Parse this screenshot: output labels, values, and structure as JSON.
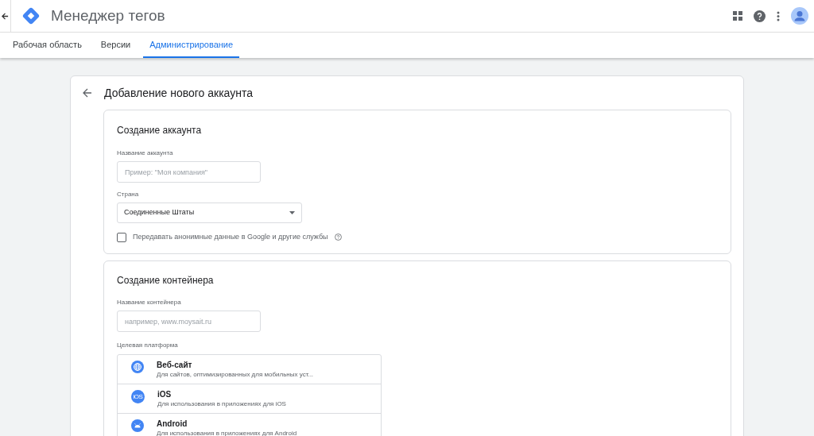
{
  "app_title": "Менеджер тегов",
  "tabs": [
    {
      "label": "Рабочая область",
      "selected": false
    },
    {
      "label": "Версии",
      "selected": false
    },
    {
      "label": "Администрирование",
      "selected": true
    }
  ],
  "page_title": "Добавление нового аккаунта",
  "account_section": {
    "title": "Создание аккаунта",
    "name_label": "Название аккаунта",
    "name_placeholder": "Пример: \"Моя компания\"",
    "country_label": "Страна",
    "country_value": "Соединенные Штаты",
    "share_checkbox": {
      "label": "Передавать анонимные данные в Google и другие службы",
      "checked": false
    }
  },
  "container_section": {
    "title": "Создание контейнера",
    "name_label": "Название контейнера",
    "name_placeholder": "например, www.moysait.ru",
    "platform_label": "Целевая платформа",
    "platforms": [
      {
        "kind": "web",
        "name": "Веб-сайт",
        "description": "Для сайтов, оптимизированных для мобильных уст..."
      },
      {
        "kind": "ios",
        "badge": "iOS",
        "name": "iOS",
        "description": "Для использования в приложениях для iOS"
      },
      {
        "kind": "android",
        "name": "Android",
        "description": "Для использования в приложениях для Android"
      }
    ]
  }
}
